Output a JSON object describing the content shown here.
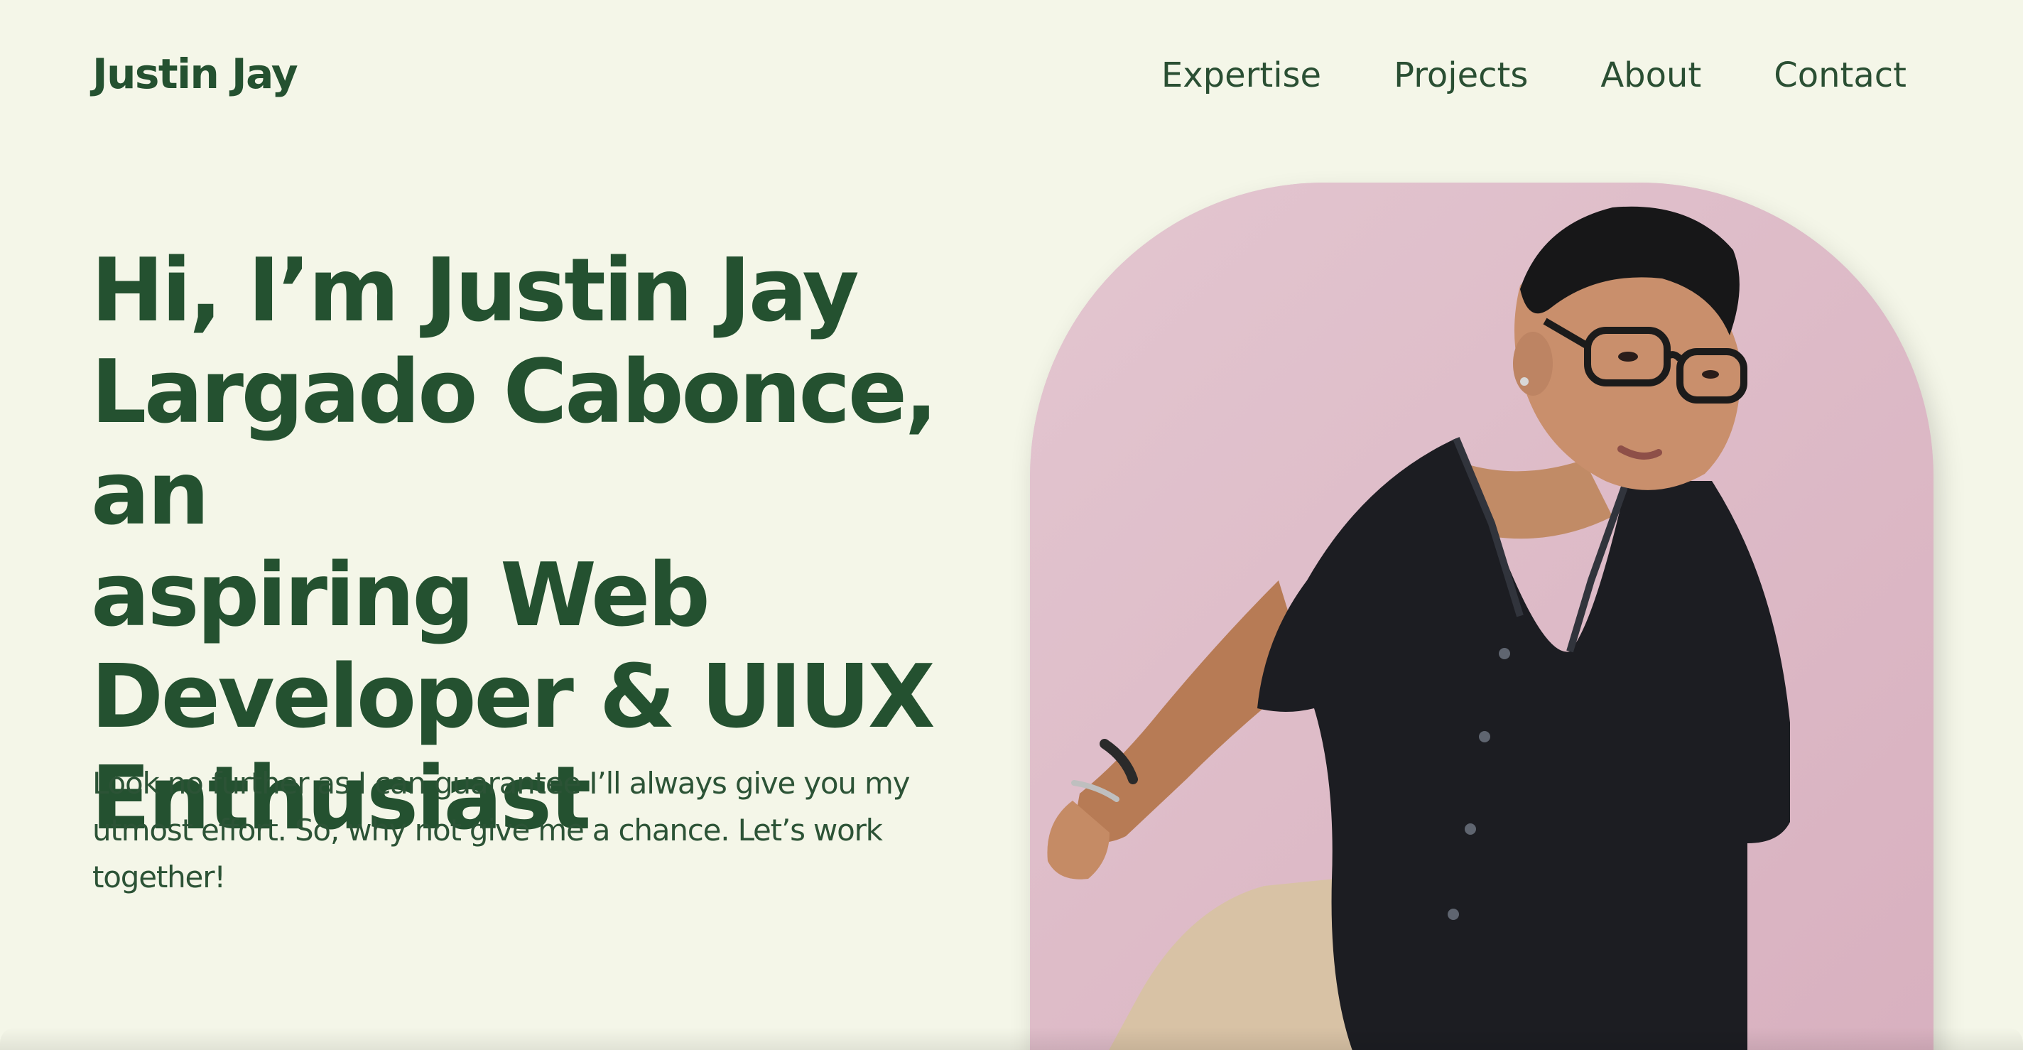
{
  "header": {
    "brand": "Justin Jay",
    "nav": [
      "Expertise",
      "Projects",
      "About",
      "Contact"
    ]
  },
  "hero": {
    "headline_lines": [
      "Hi, I’m Justin Jay",
      "Largado Cabonce, an",
      "aspiring Web",
      "Developer & UIUX",
      "Enthusiast"
    ],
    "subtext_lines": [
      "Look no further as I can guarantee I’ll always give you my",
      "utmost effort. So, why not give me a chance. Let’s work",
      "together!"
    ]
  },
  "colors": {
    "background": "#f4f6e8",
    "primary_green": "#245130",
    "photo_backdrop": "#dfbfca"
  },
  "images": {
    "portrait": "portrait-photo"
  }
}
